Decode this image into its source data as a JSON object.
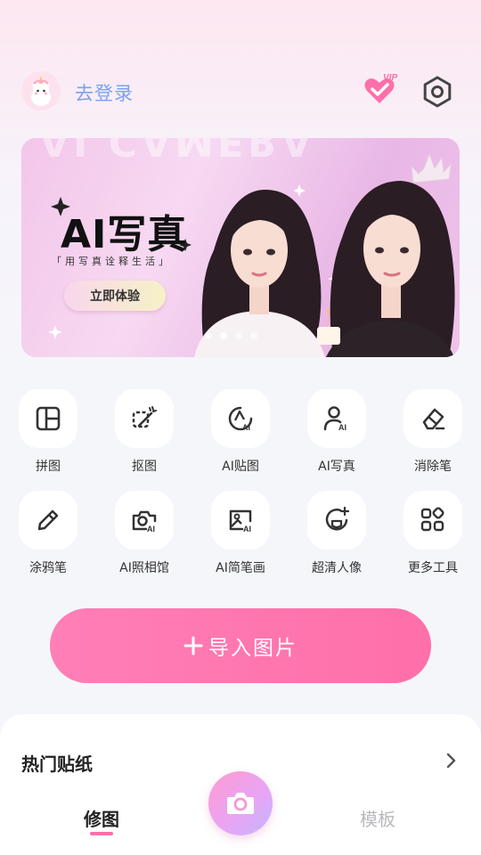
{
  "header": {
    "login_text": "去登录",
    "avatar_icon": "unicorn-avatar",
    "vip_icon": "vip-heart-icon",
    "settings_icon": "settings-icon"
  },
  "banner": {
    "ghost_text": "AI CAMERA",
    "title": "AI写真",
    "subtitle": "「用写真诠释生活」",
    "button_label": "立即体验",
    "pages": 4,
    "active_page": 2
  },
  "tools": [
    {
      "label": "拼图",
      "icon": "collage-icon"
    },
    {
      "label": "抠图",
      "icon": "cutout-icon"
    },
    {
      "label": "AI贴图",
      "icon": "ai-sticker-icon"
    },
    {
      "label": "AI写真",
      "icon": "ai-portrait-icon"
    },
    {
      "label": "消除笔",
      "icon": "eraser-icon"
    },
    {
      "label": "涂鸦笔",
      "icon": "pencil-icon"
    },
    {
      "label": "AI照相馆",
      "icon": "ai-camera-icon"
    },
    {
      "label": "AI简笔画",
      "icon": "ai-sketch-icon"
    },
    {
      "label": "超清人像",
      "icon": "hd-portrait-icon"
    },
    {
      "label": "更多工具",
      "icon": "more-tools-icon"
    }
  ],
  "import_button": {
    "label": "导入图片",
    "icon": "plus-icon"
  },
  "sheet": {
    "title": "热门贴纸",
    "chevron_icon": "chevron-right-icon"
  },
  "bottom_nav": {
    "tab_edit": "修图",
    "tab_template": "模板",
    "camera_icon": "camera-icon"
  },
  "colors": {
    "accent_pink": "#ff6fa9",
    "login_blue": "#7aa2f0"
  }
}
